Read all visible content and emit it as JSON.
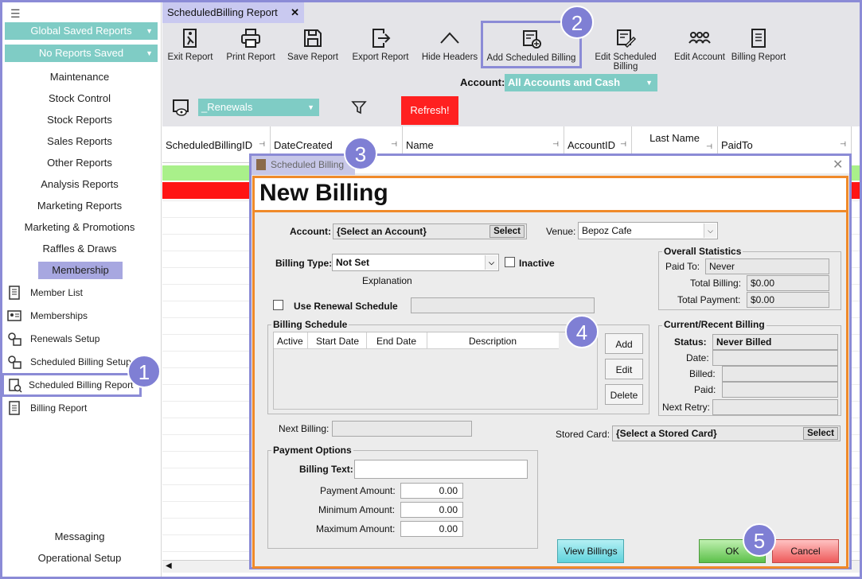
{
  "sidebar": {
    "dropdown_1": "Global Saved Reports",
    "dropdown_2": "No Reports Saved",
    "items": [
      "Maintenance",
      "Stock Control",
      "Stock Reports",
      "Sales Reports",
      "Other Reports",
      "Analysis Reports",
      "Marketing Reports",
      "Marketing & Promotions",
      "Raffles & Draws",
      "Membership"
    ],
    "sub_items": [
      "Member List",
      "Memberships",
      "Renewals Setup",
      "Scheduled Billing Setup",
      "Scheduled Billing Report",
      "Billing Report"
    ],
    "bottom_items": [
      "Messaging",
      "Operational Setup"
    ]
  },
  "tab": {
    "label": "ScheduledBilling Report",
    "close": "✕"
  },
  "toolbar": [
    "Exit Report",
    "Print Report",
    "Save Report",
    "Export Report",
    "Hide Headers",
    "Add Scheduled Billing",
    "Edit Scheduled Billing",
    "Edit Account",
    "Billing Report"
  ],
  "account": {
    "label": "Account:",
    "value": "All Accounts and Cash"
  },
  "view_select": "_Renewals",
  "refresh_label": "Refresh!",
  "grid": {
    "columns": [
      "ScheduledBillingID",
      "DateCreated",
      "Name",
      "AccountID",
      "Last Name",
      "PaidTo"
    ]
  },
  "dialog": {
    "title": "Scheduled Billing",
    "heading": "New Billing",
    "account_label": "Account:",
    "account_value": "{Select an Account}",
    "select_label": "Select",
    "venue_label": "Venue:",
    "venue_value": "Bepoz Cafe",
    "billing_type_label": "Billing Type:",
    "billing_type_value": "Not Set",
    "inactive_label": "Inactive",
    "explanation": "Explanation",
    "use_renewal_label": "Use Renewal Schedule",
    "overall": {
      "title": "Overall Statistics",
      "paid_to_label": "Paid To:",
      "paid_to": "Never",
      "total_billing_label": "Total Billing:",
      "total_billing": "$0.00",
      "total_payment_label": "Total Payment:",
      "total_payment": "$0.00"
    },
    "schedule": {
      "title": "Billing Schedule",
      "columns": [
        "Active",
        "Start Date",
        "End Date",
        "Description"
      ],
      "add": "Add",
      "edit": "Edit",
      "delete": "Delete"
    },
    "current": {
      "title": "Current/Recent Billing",
      "status_label": "Status:",
      "status": "Never Billed",
      "date_label": "Date:",
      "billed_label": "Billed:",
      "paid_label": "Paid:",
      "next_retry_label": "Next Retry:"
    },
    "next_billing_label": "Next Billing:",
    "stored_card_label": "Stored Card:",
    "stored_card_value": "{Select a Stored Card}",
    "payment": {
      "title": "Payment Options",
      "billing_text_label": "Billing Text:",
      "payment_amount_label": "Payment Amount:",
      "payment_amount": "0.00",
      "minimum_amount_label": "Minimum Amount:",
      "minimum_amount": "0.00",
      "maximum_amount_label": "Maximum Amount:",
      "maximum_amount": "0.00"
    },
    "view_billings": "View Billings",
    "ok": "OK",
    "cancel": "Cancel"
  },
  "callouts": [
    "1",
    "2",
    "3",
    "4",
    "5"
  ],
  "colors": {
    "teal": "#7fccc5",
    "highlight": "#8b8bd6",
    "orange": "#f08a2a",
    "refresh": "#ff2020"
  }
}
